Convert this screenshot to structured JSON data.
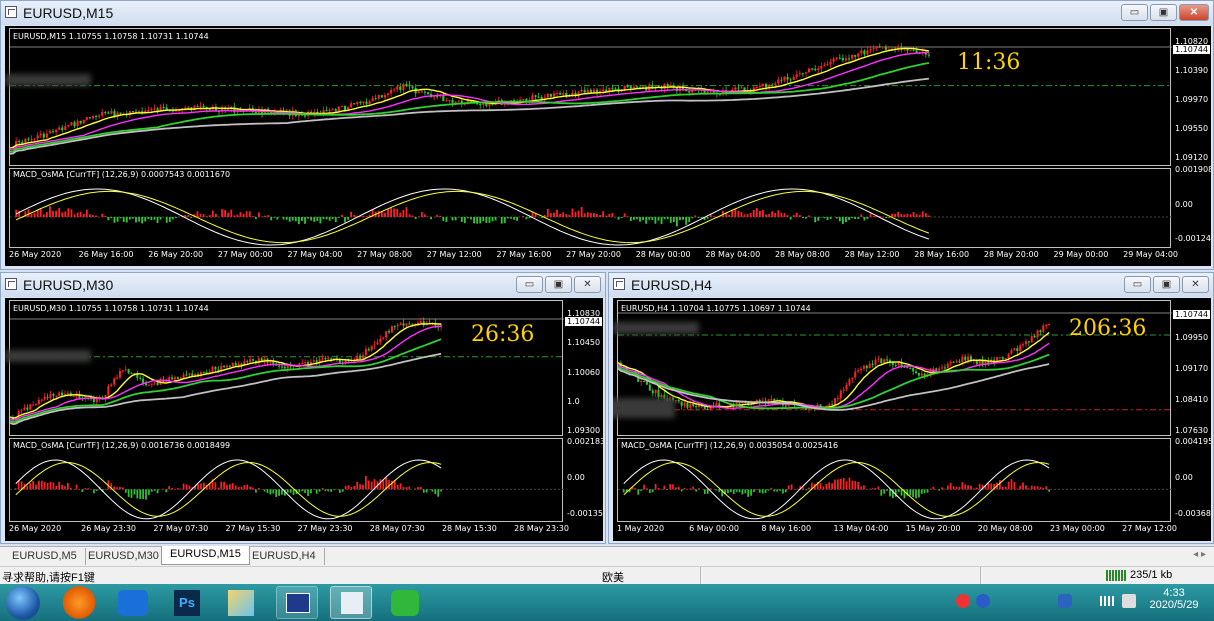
{
  "charts": [
    {
      "title": "EURUSD,M15",
      "info": "EURUSD,M15  1.10755 1.10758 1.10731 1.10744",
      "macd_info": "MACD_OsMA [CurrTF] (12,26,9) 0.0007543 0.0011670",
      "timer": "11:36",
      "price_tag": "1.10744",
      "price_labels": [
        "1.10820",
        "1.10390",
        "1.09970",
        "1.09550",
        "1.09120"
      ],
      "macd_labels": [
        "0.0019084",
        "0.00",
        "-0.001240"
      ],
      "time_labels": [
        "26 May 2020",
        "26 May 16:00",
        "26 May 20:00",
        "27 May 00:00",
        "27 May 04:00",
        "27 May 08:00",
        "27 May 12:00",
        "27 May 16:00",
        "27 May 20:00",
        "28 May 00:00",
        "28 May 04:00",
        "28 May 08:00",
        "28 May 12:00",
        "28 May 16:00",
        "28 May 20:00",
        "29 May 00:00",
        "29 May 04:00"
      ]
    },
    {
      "title": "EURUSD,M30",
      "info": "EURUSD,M30  1.10755 1.10758 1.10731 1.10744",
      "macd_info": "MACD_OsMA [CurrTF] (12,26,9) 0.0016736 0.0018499",
      "timer": "26:36",
      "price_tag": "1.10744",
      "price_labels": [
        "1.10830",
        "1.10450",
        "1.10060",
        "1.0",
        "1.09300"
      ],
      "macd_labels": [
        "0.0021838",
        "0.00",
        "-0.001358"
      ],
      "time_labels": [
        "26 May 2020",
        "26 May 23:30",
        "27 May 07:30",
        "27 May 15:30",
        "27 May 23:30",
        "28 May 07:30",
        "28 May 15:30",
        "28 May 23:30"
      ]
    },
    {
      "title": "EURUSD,H4",
      "info": "EURUSD,H4  1.10704 1.10775 1.10697 1.10744",
      "macd_info": "MACD_OsMA [CurrTF] (12,26,9) 0.0035054 0.0025416",
      "timer": "206:36",
      "price_tag": "1.10744",
      "price_labels": [
        "1.09950",
        "1.09170",
        "1.08410",
        "1.07630"
      ],
      "macd_labels": [
        "0.0041958",
        "0.00",
        "-0.003681"
      ],
      "time_labels": [
        "1 May 2020",
        "6 May 00:00",
        "8 May 16:00",
        "13 May 04:00",
        "15 May 20:00",
        "20 May 08:00",
        "23 May 00:00",
        "27 May 12:00"
      ]
    }
  ],
  "tabs": [
    "EURUSD,M5",
    "EURUSD,M30",
    "EURUSD,M15",
    "EURUSD,H4"
  ],
  "status": {
    "help": "寻求帮助,请按F1键",
    "profile": "欧美",
    "traffic": "235/1 kb"
  },
  "clock": {
    "time": "4:33",
    "date": "2020/5/29"
  },
  "window_buttons": {
    "minimize": "▭",
    "restore": "▣",
    "close": "✕"
  },
  "colors": {
    "bull": "#ff2020",
    "bear": "#2dc82d",
    "ma_fast": "#ffff30",
    "ma_mid": "#ff30ff",
    "ma_slow": "#30d030",
    "ma_long": "#c0c0c0",
    "timer": "#ffd200"
  }
}
